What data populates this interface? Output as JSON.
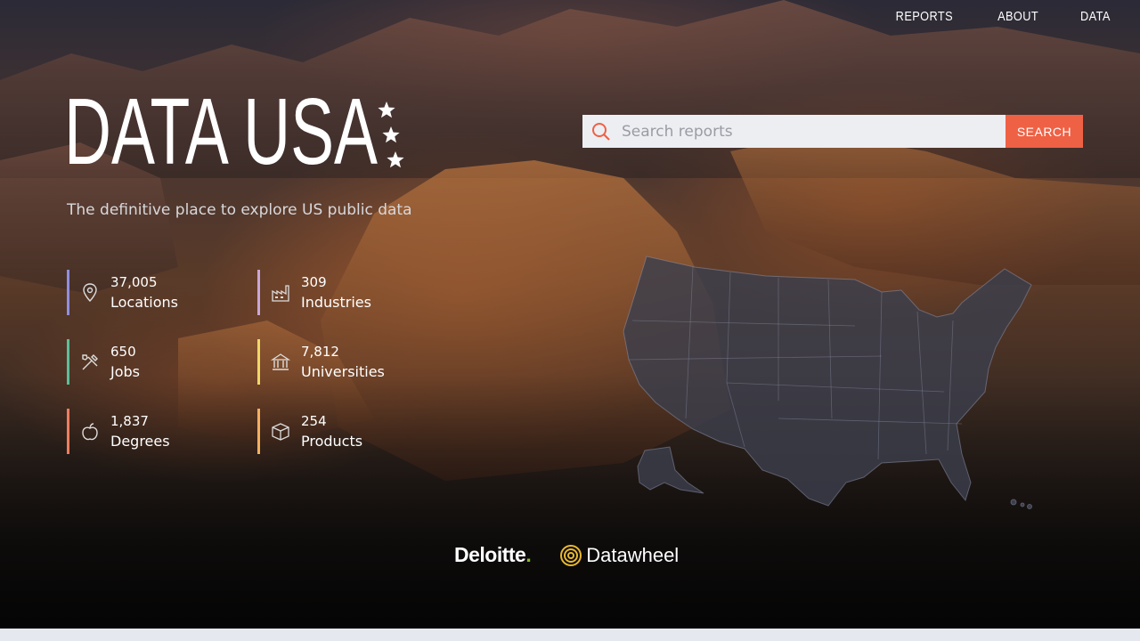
{
  "nav": {
    "items": [
      "REPORTS",
      "ABOUT",
      "DATA"
    ]
  },
  "brand": {
    "title": "DATA USA",
    "tagline": "The definitive place to explore US public data"
  },
  "search": {
    "placeholder": "Search reports",
    "button_label": "SEARCH"
  },
  "stats": [
    {
      "value": "37,005",
      "label": "Locations",
      "icon": "location-pin-icon",
      "color": "#8f8fe0"
    },
    {
      "value": "309",
      "label": "Industries",
      "icon": "factory-icon",
      "color": "#c8a8d8"
    },
    {
      "value": "650",
      "label": "Jobs",
      "icon": "tools-icon",
      "color": "#5bbf9a"
    },
    {
      "value": "7,812",
      "label": "Universities",
      "icon": "university-icon",
      "color": "#f0d868"
    },
    {
      "value": "1,837",
      "label": "Degrees",
      "icon": "apple-icon",
      "color": "#ef7d5e"
    },
    {
      "value": "254",
      "label": "Products",
      "icon": "box-icon",
      "color": "#f4b060"
    }
  ],
  "partners": {
    "deloitte": "Deloitte",
    "deloitte_dot": ".",
    "datawheel": "Datawheel"
  },
  "colors": {
    "accent": "#ef6145",
    "search_bg": "#eceef2",
    "map_fill": "#3a3c4a"
  }
}
